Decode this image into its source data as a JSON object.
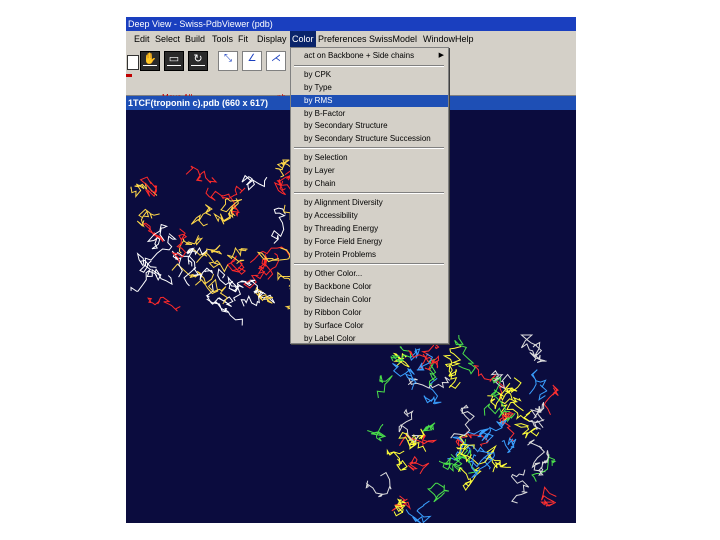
{
  "app": {
    "titlebar": "Deep View - Swiss-PdbViewer (pdb)",
    "menus": [
      "Edit",
      "Select",
      "Build",
      "Tools",
      "Fit",
      "Display",
      "Color",
      "Preferences",
      "SwissModel",
      "Window",
      "Help"
    ],
    "active_menu": "Color"
  },
  "toolbar": {
    "move_label": "Move All",
    "ph_label": "ph"
  },
  "window": {
    "title": "1TCF(troponin c).pdb (660 x 617)"
  },
  "color_menu": {
    "items": [
      {
        "label": "act on Backbone + Side chains",
        "submenu": true
      },
      {
        "label": "by CPK"
      },
      {
        "label": "by Type"
      },
      {
        "label": "by RMS",
        "selected": true
      },
      {
        "label": "by B-Factor"
      },
      {
        "label": "by Secondary Structure"
      },
      {
        "label": "by Secondary Structure Succession"
      },
      {
        "label": "by Selection"
      },
      {
        "label": "by Layer"
      },
      {
        "label": "by Chain"
      },
      {
        "label": "by Alignment Diversity"
      },
      {
        "label": "by Accessibility"
      },
      {
        "label": "by Threading Energy"
      },
      {
        "label": "by Force Field Energy"
      },
      {
        "label": "by Protein Problems"
      },
      {
        "label": "by Other Color..."
      },
      {
        "label": "by Backbone Color"
      },
      {
        "label": "by Sidechain Color"
      },
      {
        "label": "by Ribbon Color"
      },
      {
        "label": "by Surface Color"
      },
      {
        "label": "by Label Color"
      }
    ]
  },
  "colors": {
    "viewer_background": "#0b0c3e",
    "selection_blue": "#1e4fb5",
    "model1_colors": [
      "#ff2a2a",
      "#ffd84a",
      "#ffffff"
    ],
    "model2_colors": [
      "#ffff3a",
      "#3aa0ff",
      "#4ae04a",
      "#ff3030",
      "#dddddd"
    ]
  },
  "icons": [
    "document-icon",
    "hand-move-icon",
    "translate-icon",
    "rotate-icon",
    "measure-distance-icon",
    "measure-angle-icon",
    "measure-dihedral-icon",
    "center-icon"
  ]
}
